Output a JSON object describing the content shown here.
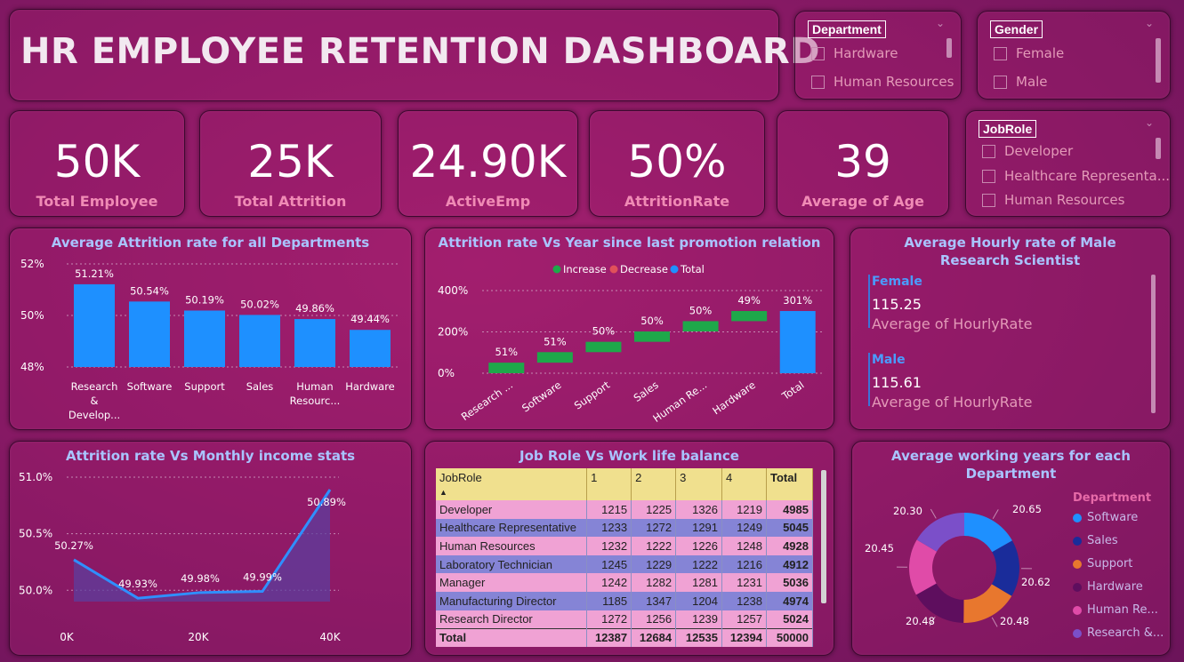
{
  "title": "HR EMPLOYEE RETENTION DASHBOARD",
  "slicers": {
    "department": {
      "title": "Department",
      "items": [
        "Hardware",
        "Human Resources"
      ]
    },
    "gender": {
      "title": "Gender",
      "items": [
        "Female",
        "Male"
      ]
    },
    "jobrole": {
      "title": "JobRole",
      "items": [
        "Developer",
        "Healthcare Representa...",
        "Human Resources"
      ]
    }
  },
  "kpis": [
    {
      "value": "50K",
      "label": "Total Employee"
    },
    {
      "value": "25K",
      "label": "Total Attrition"
    },
    {
      "value": "24.90K",
      "label": "ActiveEmp"
    },
    {
      "value": "50%",
      "label": "AttritionRate"
    },
    {
      "value": "39",
      "label": "Average of Age"
    }
  ],
  "hourly": {
    "title": "Average Hourly rate of Male Research Scientist",
    "female_label": "Female",
    "female_value": "115.25",
    "female_sub": "Average of HourlyRate",
    "male_label": "Male",
    "male_value": "115.61",
    "male_sub": "Average of HourlyRate"
  },
  "table": {
    "title": "Job Role Vs Work life balance",
    "headers": [
      "JobRole",
      "1",
      "2",
      "3",
      "4",
      "Total"
    ],
    "rows": [
      [
        "Developer",
        "1215",
        "1225",
        "1326",
        "1219",
        "4985"
      ],
      [
        "Healthcare Representative",
        "1233",
        "1272",
        "1291",
        "1249",
        "5045"
      ],
      [
        "Human Resources",
        "1232",
        "1222",
        "1226",
        "1248",
        "4928"
      ],
      [
        "Laboratory Technician",
        "1245",
        "1229",
        "1222",
        "1216",
        "4912"
      ],
      [
        "Manager",
        "1242",
        "1282",
        "1281",
        "1231",
        "5036"
      ],
      [
        "Manufacturing Director",
        "1185",
        "1347",
        "1204",
        "1238",
        "4974"
      ],
      [
        "Research Director",
        "1272",
        "1256",
        "1239",
        "1257",
        "5024"
      ]
    ],
    "footer": [
      "Total",
      "12387",
      "12684",
      "12535",
      "12394",
      "50000"
    ]
  },
  "colors": {
    "bar": "#1e90ff",
    "increase": "#1ea84a",
    "decrease": "#e0515a",
    "total": "#1e90ff",
    "area_line": "#2f8fff",
    "area_fill": "#5c3d9e"
  },
  "chart_data": [
    {
      "type": "bar",
      "title": "Average Attrition rate for all Departments",
      "categories": [
        "Research & Develop...",
        "Software",
        "Support",
        "Sales",
        "Human Resourc...",
        "Hardware"
      ],
      "values": [
        51.21,
        50.54,
        50.19,
        50.02,
        49.86,
        49.44
      ],
      "data_labels": [
        "51.21%",
        "50.54%",
        "50.19%",
        "50.02%",
        "49.86%",
        "49.44%"
      ],
      "yticks": [
        "52%",
        "50%",
        "48%"
      ],
      "ylim": [
        48,
        52
      ],
      "grid": true
    },
    {
      "type": "waterfall",
      "title": "Attrition rate Vs Year since last promotion relation",
      "legend": [
        "Increase",
        "Decrease",
        "Total"
      ],
      "categories": [
        "Research ...",
        "Software",
        "Support",
        "Sales",
        "Human Re...",
        "Hardware",
        "Total"
      ],
      "values": [
        51,
        51,
        50,
        50,
        50,
        49,
        301
      ],
      "data_labels": [
        "51%",
        "51%",
        "50%",
        "50%",
        "50%",
        "49%",
        "301%"
      ],
      "yticks": [
        "400%",
        "200%",
        "0%"
      ],
      "ylim": [
        0,
        400
      ],
      "grid": true
    },
    {
      "type": "area",
      "title": "Attrition rate Vs Monthly income stats",
      "x": [
        0,
        10000,
        20000,
        30000,
        40000
      ],
      "values": [
        50.27,
        49.93,
        49.98,
        49.99,
        50.89
      ],
      "data_labels": [
        "50.27%",
        "49.93%",
        "49.98%",
        "49.99%",
        "50.89%"
      ],
      "xticks": [
        "0K",
        "20K",
        "40K"
      ],
      "yticks": [
        "51.0%",
        "50.5%",
        "50.0%"
      ],
      "ylim": [
        49.9,
        51.0
      ],
      "grid": true
    },
    {
      "type": "pie",
      "title": "Average working years for each Department",
      "legend_title": "Department",
      "categories": [
        "Software",
        "Sales",
        "Support",
        "Hardware",
        "Human Re...",
        "Research &..."
      ],
      "values": [
        20.65,
        20.62,
        20.48,
        20.48,
        20.45,
        20.3
      ],
      "data_labels": [
        "20.65",
        "20.62",
        "20.48",
        "20.48",
        "20.45",
        "20.30"
      ],
      "colors": [
        "#1e90ff",
        "#1a2c9a",
        "#e8772e",
        "#5e0e5e",
        "#e04ba8",
        "#7b4fc9"
      ]
    }
  ]
}
